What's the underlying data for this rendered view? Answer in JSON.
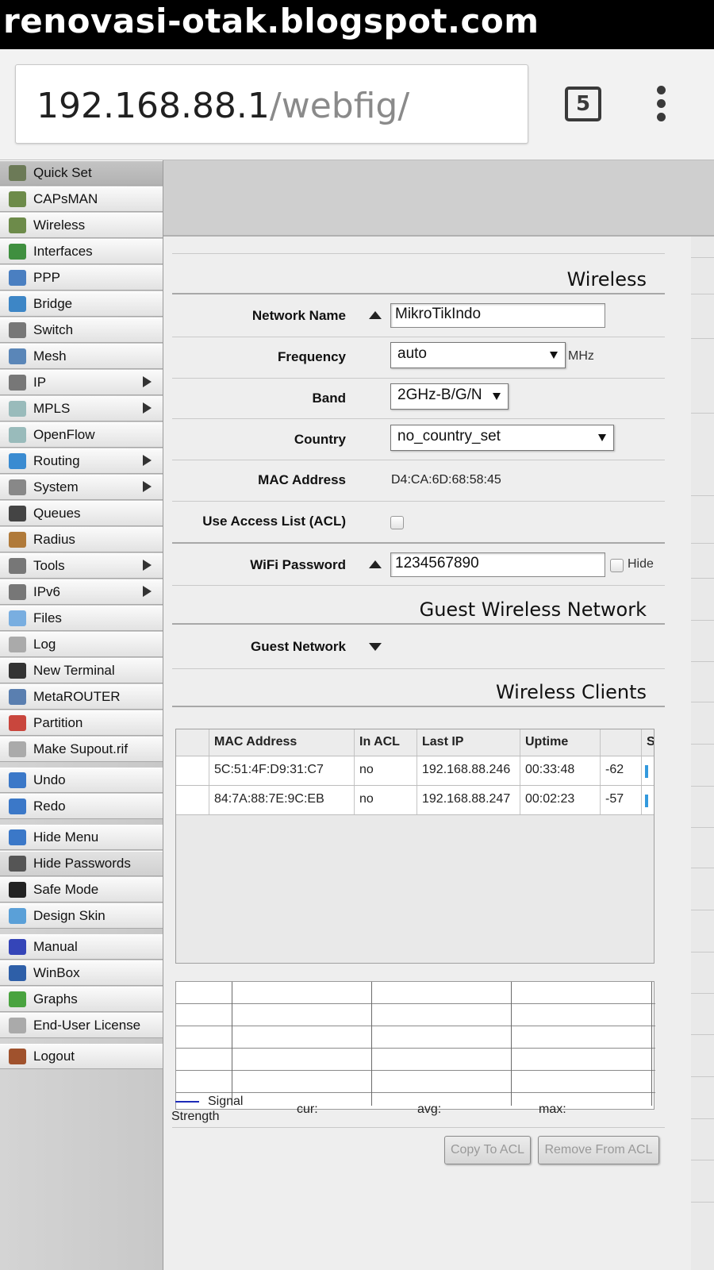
{
  "watermark": "renovasi-otak.blogspot.com",
  "browser": {
    "url_host": "192.168.88.1",
    "url_path": "/webfig/",
    "tab_count": "5"
  },
  "sidebar": {
    "groups": [
      [
        "Quick Set",
        "CAPsMAN",
        "Wireless",
        "Interfaces",
        "PPP",
        "Bridge",
        "Switch",
        "Mesh",
        "IP",
        "MPLS",
        "OpenFlow",
        "Routing",
        "System",
        "Queues",
        "Radius",
        "Tools",
        "IPv6",
        "Files",
        "Log",
        "New Terminal",
        "MetaROUTER",
        "Partition",
        "Make Supout.rif"
      ],
      [
        "Undo",
        "Redo"
      ],
      [
        "Hide Menu",
        "Hide Passwords",
        "Safe Mode",
        "Design Skin"
      ],
      [
        "Manual",
        "WinBox",
        "Graphs",
        "End-User License"
      ],
      [
        "Logout"
      ]
    ],
    "selected": "Quick Set"
  },
  "wireless": {
    "title": "Wireless",
    "network_name_label": "Network Name",
    "network_name": "MikroTikIndo",
    "frequency_label": "Frequency",
    "frequency": "auto",
    "frequency_unit": "MHz",
    "band_label": "Band",
    "band": "2GHz-B/G/N",
    "country_label": "Country",
    "country": "no_country_set",
    "mac_label": "MAC Address",
    "mac": "D4:CA:6D:68:58:45",
    "acl_label": "Use Access List (ACL)",
    "password_label": "WiFi Password",
    "password": "1234567890",
    "hide_label": "Hide"
  },
  "guest": {
    "title": "Guest Wireless Network",
    "network_label": "Guest Network"
  },
  "clients": {
    "title": "Wireless Clients",
    "columns": [
      "",
      "MAC Address",
      "In ACL",
      "Last IP",
      "Uptime",
      "",
      "S"
    ],
    "rows": [
      [
        "",
        "5C:51:4F:D9:31:C7",
        "no",
        "192.168.88.246",
        "00:33:48",
        "-62",
        ""
      ],
      [
        "",
        "84:7A:88:7E:9C:EB",
        "no",
        "192.168.88.247",
        "00:02:23",
        "-57",
        ""
      ]
    ]
  },
  "graph": {
    "legend": "Signal Strength",
    "cur_label": "cur:",
    "avg_label": "avg:",
    "max_label": "max:"
  },
  "actions": {
    "copy_to_acl": "Copy To ACL",
    "remove_from_acl": "Remove From ACL"
  },
  "colors": {
    "signal_line": "#1d2bb8",
    "signal_bar": "#3399dd"
  }
}
